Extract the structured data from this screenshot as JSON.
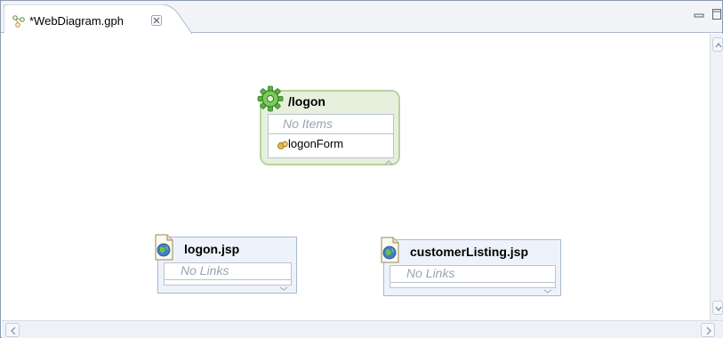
{
  "editor": {
    "tab_title": "*WebDiagram.gph"
  },
  "diagram": {
    "action": {
      "name": "/logon",
      "items_placeholder": "No Items",
      "form_bean": "logonForm"
    },
    "pages": [
      {
        "name": "logon.jsp",
        "links_placeholder": "No Links"
      },
      {
        "name": "customerListing.jsp",
        "links_placeholder": "No Links"
      }
    ]
  },
  "icons": {
    "tab": "web-diagram-icon",
    "close": "close-icon",
    "action": "gear-icon",
    "form_bean": "form-bean-icon",
    "page": "jsp-page-icon"
  },
  "colors": {
    "action_fill": "#e6f0dd",
    "action_border": "#b8d3a3",
    "page_fill": "#eef3fb",
    "page_border": "#a9b8d1",
    "placeholder_text": "#9aa4b1"
  }
}
